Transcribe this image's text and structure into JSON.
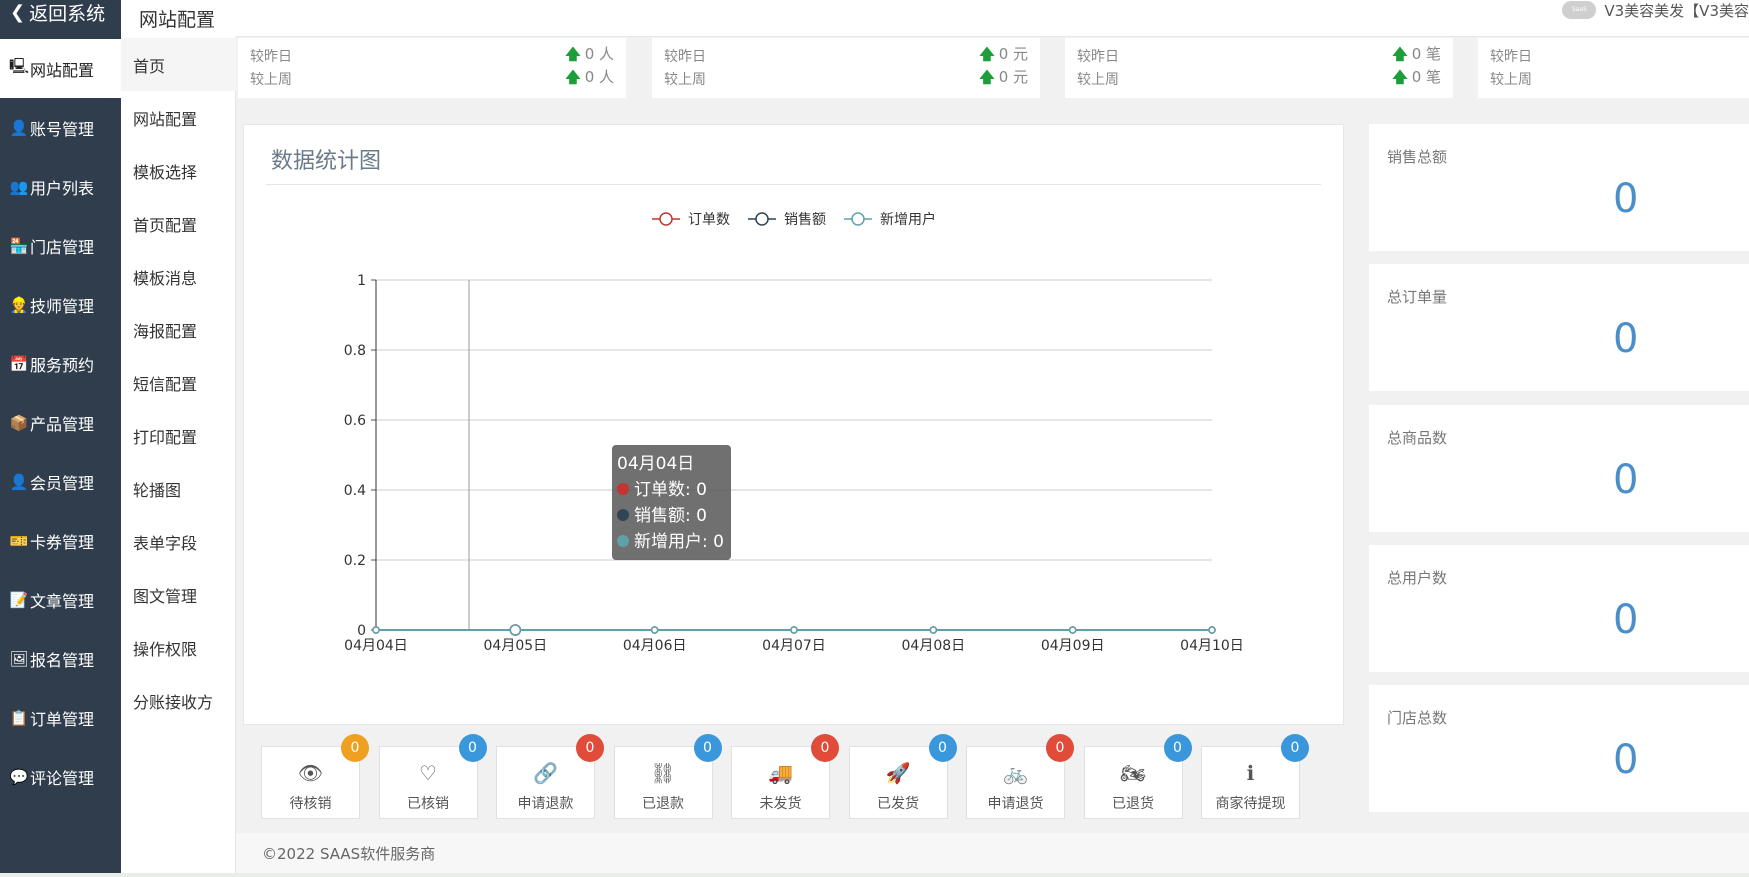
{
  "sidebar": {
    "back_label": "返回系统",
    "items": [
      {
        "label": "网站配置",
        "icon": "monitor-icon",
        "glyph": "🖳",
        "active": true
      },
      {
        "label": "账号管理",
        "icon": "user-lock-icon",
        "glyph": "👤",
        "active": false
      },
      {
        "label": "用户列表",
        "icon": "user-list-icon",
        "glyph": "👥",
        "active": false
      },
      {
        "label": "门店管理",
        "icon": "store-icon",
        "glyph": "🏪",
        "active": false
      },
      {
        "label": "技师管理",
        "icon": "technician-icon",
        "glyph": "👷",
        "active": false
      },
      {
        "label": "服务预约",
        "icon": "calendar-icon",
        "glyph": "📅",
        "active": false
      },
      {
        "label": "产品管理",
        "icon": "cubes-icon",
        "glyph": "📦",
        "active": false
      },
      {
        "label": "会员管理",
        "icon": "member-icon",
        "glyph": "👤",
        "active": false
      },
      {
        "label": "卡券管理",
        "icon": "ticket-icon",
        "glyph": "🎫",
        "active": false
      },
      {
        "label": "文章管理",
        "icon": "article-icon",
        "glyph": "📝",
        "active": false
      },
      {
        "label": "报名管理",
        "icon": "signup-icon",
        "glyph": "🖼",
        "active": false
      },
      {
        "label": "订单管理",
        "icon": "order-icon",
        "glyph": "📋",
        "active": false
      },
      {
        "label": "评论管理",
        "icon": "comment-icon",
        "glyph": "💬",
        "active": false
      }
    ]
  },
  "submenu": {
    "title": "网站配置",
    "items": [
      "首页",
      "网站配置",
      "模板选择",
      "首页配置",
      "模板消息",
      "海报配置",
      "短信配置",
      "打印配置",
      "轮播图",
      "表单字段",
      "图文管理",
      "操作权限",
      "分账接收方"
    ]
  },
  "header": {
    "account_text": "V3美容美发【V3美容",
    "logo_text": "SaaS"
  },
  "stats": [
    {
      "label_day": "较昨日",
      "label_week": "较上周",
      "day_value": "0 人",
      "week_value": "0 人"
    },
    {
      "label_day": "较昨日",
      "label_week": "较上周",
      "day_value": "0 元",
      "week_value": "0 元"
    },
    {
      "label_day": "较昨日",
      "label_week": "较上周",
      "day_value": "0 笔",
      "week_value": "0 笔"
    },
    {
      "label_day": "较昨日",
      "label_week": "较上周",
      "day_value": "",
      "week_value": ""
    }
  ],
  "chart_panel": {
    "title": "数据统计图"
  },
  "chart_data": {
    "type": "line",
    "categories": [
      "04月04日",
      "04月05日",
      "04月06日",
      "04月07日",
      "04月08日",
      "04月09日",
      "04月10日"
    ],
    "series": [
      {
        "name": "订单数",
        "values": [
          0,
          0,
          0,
          0,
          0,
          0,
          0
        ],
        "color": "#c23531"
      },
      {
        "name": "销售额",
        "values": [
          0,
          0,
          0,
          0,
          0,
          0,
          0
        ],
        "color": "#2f4554"
      },
      {
        "name": "新增用户",
        "values": [
          0,
          0,
          0,
          0,
          0,
          0,
          0
        ],
        "color": "#61a0a8"
      }
    ],
    "y_ticks": [
      "0",
      "0.2",
      "0.4",
      "0.6",
      "0.8",
      "1"
    ],
    "ylim": [
      0,
      1
    ],
    "legend": "top-center",
    "grid": true,
    "tooltip": {
      "title": "04月04日",
      "rows": [
        "订单数: 0",
        "销售额: 0",
        "新增用户: 0"
      ]
    }
  },
  "summary": [
    {
      "label": "销售总额",
      "value": "0"
    },
    {
      "label": "总订单量",
      "value": "0"
    },
    {
      "label": "总商品数",
      "value": "0"
    },
    {
      "label": "总用户数",
      "value": "0"
    },
    {
      "label": "门店总数",
      "value": "0"
    }
  ],
  "order_status": [
    {
      "label": "待核销",
      "count": "0",
      "icon": "eye-icon",
      "glyph": "👁",
      "badge_color": "#f0a020"
    },
    {
      "label": "已核销",
      "count": "0",
      "icon": "heart-icon",
      "glyph": "♡",
      "badge_color": "#3a97dc"
    },
    {
      "label": "申请退款",
      "count": "0",
      "icon": "link-icon",
      "glyph": "🔗",
      "badge_color": "#e04b3a"
    },
    {
      "label": "已退款",
      "count": "0",
      "icon": "unlink-icon",
      "glyph": "⛓",
      "badge_color": "#3a97dc"
    },
    {
      "label": "未发货",
      "count": "0",
      "icon": "truck-icon",
      "glyph": "🚚",
      "badge_color": "#e04b3a"
    },
    {
      "label": "已发货",
      "count": "0",
      "icon": "rocket-icon",
      "glyph": "🚀",
      "badge_color": "#3a97dc"
    },
    {
      "label": "申请退货",
      "count": "0",
      "icon": "bicycle-icon",
      "glyph": "🚲",
      "badge_color": "#e04b3a"
    },
    {
      "label": "已退货",
      "count": "0",
      "icon": "motorcycle-icon",
      "glyph": "🏍",
      "badge_color": "#3a97dc"
    },
    {
      "label": "商家待提现",
      "count": "0",
      "icon": "info-icon",
      "glyph": "ℹ",
      "badge_color": "#3a97dc"
    }
  ],
  "footer": {
    "text": "©2022 SAAS软件服务商"
  }
}
